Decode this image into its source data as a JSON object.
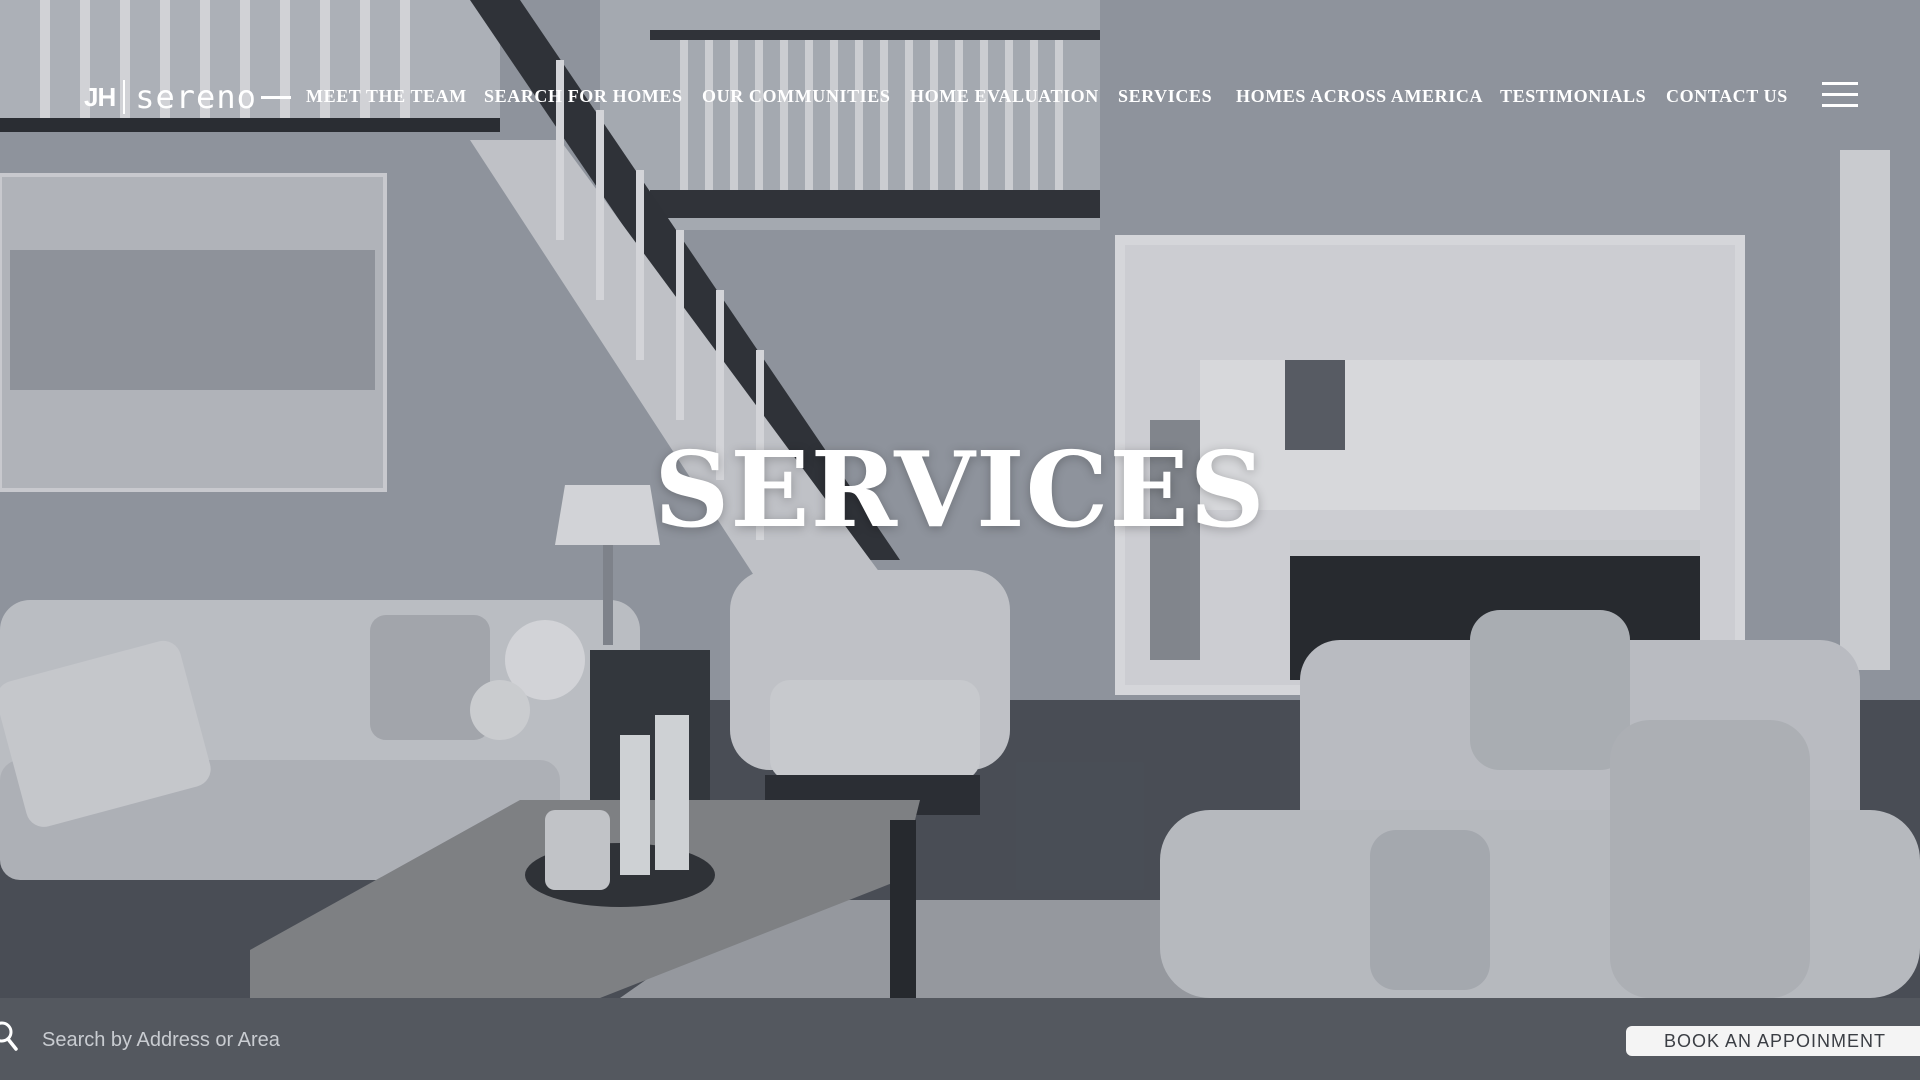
{
  "brand": {
    "mark": "JH",
    "name": "sereno"
  },
  "nav": {
    "items": [
      {
        "label": "MEET THE TEAM"
      },
      {
        "label": "SEARCH FOR HOMES"
      },
      {
        "label": "OUR COMMUNITIES"
      },
      {
        "label": "HOME EVALUATION"
      },
      {
        "label": "SERVICES"
      },
      {
        "label": "HOMES ACROSS AMERICA"
      },
      {
        "label": "TESTIMONIALS"
      },
      {
        "label": "CONTACT US"
      }
    ],
    "menu_icon": "hamburger-menu-icon"
  },
  "hero": {
    "headline": "SERVICES"
  },
  "search": {
    "placeholder": "Search by Address or Area",
    "icon": "search-icon"
  },
  "cta": {
    "book_label": "BOOK AN APPOINMENT"
  },
  "colors": {
    "bar_background": "#54585f",
    "text_light": "#ffffff",
    "button_background": "#f4f4f4"
  }
}
